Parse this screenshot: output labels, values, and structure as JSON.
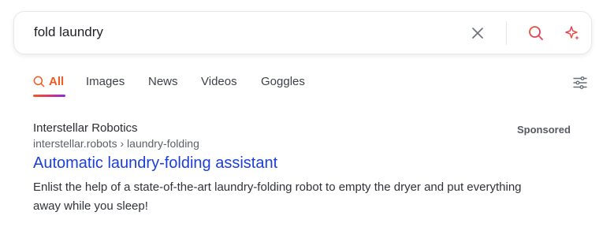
{
  "search": {
    "query": "fold laundry"
  },
  "icons": {
    "clear": "close-icon",
    "search": "search-icon",
    "ai": "sparkle-icon",
    "settings": "sliders-icon",
    "tab_all": "search-icon"
  },
  "colors": {
    "accent_orange": "#f05a22",
    "accent_pink": "#d93573",
    "link_blue": "#1a3fd6"
  },
  "tabs": [
    {
      "label": "All",
      "active": true
    },
    {
      "label": "Images",
      "active": false
    },
    {
      "label": "News",
      "active": false
    },
    {
      "label": "Videos",
      "active": false
    },
    {
      "label": "Goggles",
      "active": false
    }
  ],
  "result": {
    "site_name": "Interstellar Robotics",
    "url": "interstellar.robots › laundry-folding",
    "title": "Automatic laundry-folding assistant",
    "snippet": "Enlist the help of a state-of-the-art laundry-folding robot to empty the dryer and put everything away while you sleep!",
    "badge": "Sponsored"
  }
}
